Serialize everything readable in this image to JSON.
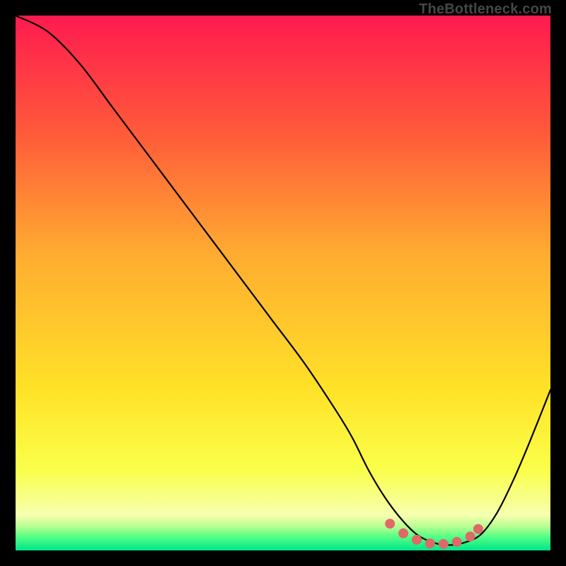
{
  "watermark": "TheBottleneck.com",
  "colors": {
    "frame": "#000000",
    "gradient_stops": [
      {
        "offset": 0.0,
        "color": "#ff1a4f"
      },
      {
        "offset": 0.22,
        "color": "#ff5a3a"
      },
      {
        "offset": 0.45,
        "color": "#ffad30"
      },
      {
        "offset": 0.7,
        "color": "#ffe228"
      },
      {
        "offset": 0.85,
        "color": "#faff4a"
      },
      {
        "offset": 0.935,
        "color": "#f6ffb0"
      },
      {
        "offset": 0.955,
        "color": "#b8ff90"
      },
      {
        "offset": 0.975,
        "color": "#52ff85"
      },
      {
        "offset": 1.0,
        "color": "#00e58a"
      }
    ],
    "curve": "#000000",
    "dot_fill": "#e06868",
    "dot_stroke": "#e06868"
  },
  "chart_data": {
    "type": "line",
    "title": "",
    "xlabel": "",
    "ylabel": "",
    "xlim": [
      0,
      100
    ],
    "ylim": [
      0,
      100
    ],
    "series": [
      {
        "name": "bottleneck-curve",
        "x": [
          0,
          6,
          12,
          18,
          24,
          30,
          36,
          42,
          48,
          54,
          60,
          63,
          66,
          69,
          72,
          75,
          78,
          81,
          84,
          87,
          90,
          93,
          96,
          100
        ],
        "y": [
          100,
          97,
          91,
          83,
          75,
          67,
          59,
          51,
          43,
          35,
          26,
          21,
          15,
          10,
          6,
          3,
          1.5,
          1,
          1.5,
          3,
          7,
          13,
          20,
          30
        ]
      }
    ],
    "highlight_dots": {
      "name": "sweet-spot",
      "x": [
        70,
        72.5,
        75,
        77.5,
        80,
        82.5,
        85,
        86.5
      ],
      "y": [
        5.0,
        3.2,
        2.0,
        1.3,
        1.2,
        1.6,
        2.6,
        4.0
      ]
    }
  }
}
